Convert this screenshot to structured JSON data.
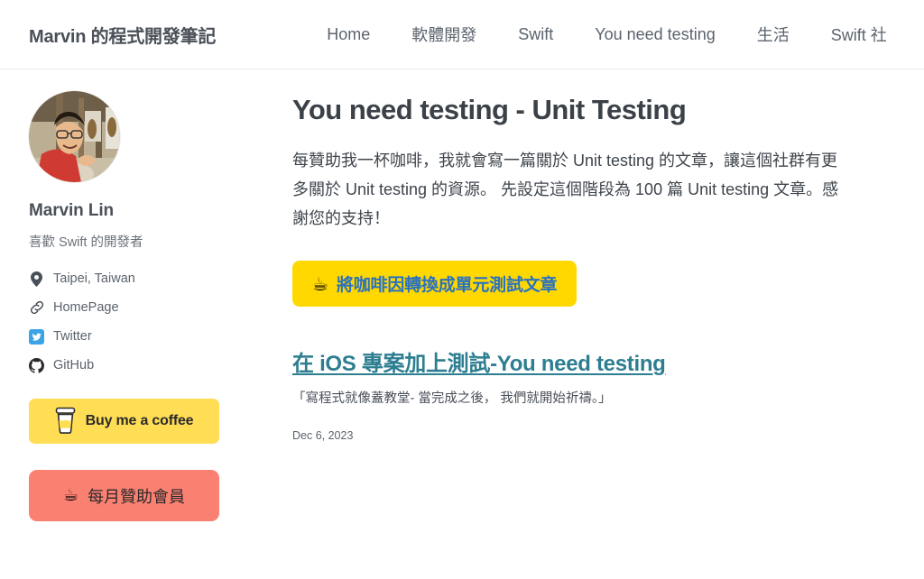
{
  "header": {
    "site_title": "Marvin 的程式開發筆記",
    "nav_items": [
      {
        "label": "Home",
        "name": "nav-item-home"
      },
      {
        "label": "軟體開發",
        "name": "nav-item-software-development"
      },
      {
        "label": "Swift",
        "name": "nav-item-swift"
      },
      {
        "label": "You need testing",
        "name": "nav-item-you-need-testing"
      },
      {
        "label": "生活",
        "name": "nav-item-life"
      },
      {
        "label": "Swift 社",
        "name": "nav-item-swift-community"
      }
    ]
  },
  "sidebar": {
    "author_name": "Marvin Lin",
    "tagline": "喜歡 Swift 的開發者",
    "meta": [
      {
        "icon": "location-pin-icon",
        "label": "Taipei, Taiwan"
      },
      {
        "icon": "link-icon",
        "label": "HomePage"
      },
      {
        "icon": "twitter-icon",
        "label": "Twitter"
      },
      {
        "icon": "github-icon",
        "label": "GitHub"
      }
    ],
    "buy_coffee_label": "Buy me a coffee",
    "sponsor_icon": "☕",
    "sponsor_label": "每月贊助會員"
  },
  "main": {
    "title": "You need testing - Unit Testing",
    "intro": "每贊助我一杯咖啡，我就會寫一篇關於 Unit testing 的文章，讓這個社群有更多關於 Unit testing 的資源。 先設定這個階段為 100 篇 Unit testing 文章。感謝您的支持！",
    "convert_button_icon": "☕",
    "convert_button_label": "將咖啡因轉換成單元測試文章",
    "article": {
      "link_text": "在 iOS 專案加上測試-You need testing",
      "excerpt": "「寫程式就像蓋教堂- 當完成之後， 我們就開始祈禱。」",
      "date": "Dec 6, 2023"
    }
  },
  "colors": {
    "coffee_yellow": "#FFDD55",
    "convert_yellow": "#FFD800",
    "sponsor_salmon": "#FA8072",
    "link_teal": "#2d7e91",
    "convert_text_blue": "#2a72c0",
    "text_slate": "#4a5059"
  }
}
